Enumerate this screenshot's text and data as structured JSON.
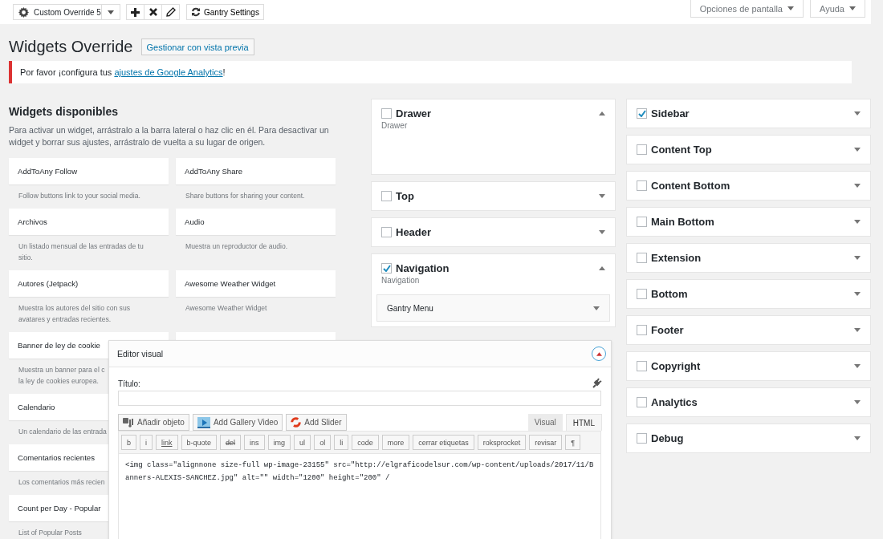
{
  "toolbar": {
    "override_select": "Custom Override 5",
    "gantry_settings": "Gantry Settings"
  },
  "screen_meta": {
    "screen_options": "Opciones de pantalla",
    "help": "Ayuda"
  },
  "page_title": "Widgets Override",
  "preview_button": "Gestionar con vista previa",
  "notice": {
    "text": "Por favor ¡configura tus ",
    "link": "ajustes de Google Analytics",
    "after": "!"
  },
  "available": {
    "title": "Widgets disponibles",
    "description": "Para activar un widget, arrástralo a la barra lateral o haz clic en él. Para desactivar un widget y borrar sus ajustes, arrástralo de vuelta a su lugar de origen.",
    "widget_rows": [
      [
        {
          "kind": "widget",
          "name": "AddToAny Follow",
          "description": [
            "Follow buttons link to your social media."
          ]
        },
        {
          "kind": "widget",
          "name": "AddToAny Share",
          "description": [
            "Share buttons for sharing your content."
          ]
        }
      ],
      [
        {
          "kind": "widget",
          "name": "Archivos",
          "description": [
            "Un listado mensual de las entradas de tu",
            "sitio."
          ]
        },
        {
          "kind": "widget",
          "name": "Audio",
          "description": [
            "Muestra un reproductor de audio."
          ]
        }
      ],
      [
        {
          "kind": "widget",
          "name": "Autores (Jetpack)",
          "description": [
            "Muestra los autores del sitio con sus",
            "avatares y entradas recientes."
          ]
        },
        {
          "kind": "widget",
          "name": "Awesome Weather Widget",
          "description": [
            "Awesome Weather Widget"
          ]
        }
      ],
      [
        {
          "kind": "widget",
          "name": "Banner de ley de cookie",
          "description": [
            "Muestra un banner para el c",
            "la ley de cookies europea."
          ]
        },
        {
          "kind": "covered"
        }
      ],
      [
        {
          "kind": "widget",
          "name": "Calendario",
          "description": [
            "Un calendario de las entrada"
          ]
        }
      ],
      [
        {
          "kind": "widget",
          "name": "Comentarios recientes",
          "description": [
            "Los comentarios más recien"
          ]
        }
      ],
      [
        {
          "kind": "widget",
          "name": "Count per Day - Popular",
          "description": [
            "List of Popular Posts"
          ]
        }
      ]
    ]
  },
  "sidebars_middle": [
    {
      "name": "Drawer",
      "checked": false,
      "expanded": true,
      "description": "Drawer"
    },
    {
      "name": "Top",
      "checked": false,
      "expanded": false
    },
    {
      "name": "Header",
      "checked": false,
      "expanded": false
    },
    {
      "name": "Navigation",
      "checked": true,
      "expanded": true,
      "description": "Navigation",
      "widgets": [
        {
          "name": "Gantry Menu"
        }
      ]
    }
  ],
  "sidebars_right": [
    {
      "name": "Sidebar",
      "checked": true,
      "expanded": false
    },
    {
      "name": "Content Top",
      "checked": false,
      "expanded": false
    },
    {
      "name": "Content Bottom",
      "checked": false,
      "expanded": false
    },
    {
      "name": "Main Bottom",
      "checked": false,
      "expanded": false
    },
    {
      "name": "Extension",
      "checked": false,
      "expanded": false
    },
    {
      "name": "Bottom",
      "checked": false,
      "expanded": false
    },
    {
      "name": "Footer",
      "checked": false,
      "expanded": false
    },
    {
      "name": "Copyright",
      "checked": false,
      "expanded": false
    },
    {
      "name": "Analytics",
      "checked": false,
      "expanded": false
    },
    {
      "name": "Debug",
      "checked": false,
      "expanded": false
    }
  ],
  "editor": {
    "title": "Editor visual",
    "field_label": "Título:",
    "media_buttons": [
      {
        "kind": "media",
        "label": "Añadir objeto"
      },
      {
        "kind": "video",
        "label": "Add Gallery Video"
      },
      {
        "kind": "slider",
        "label": "Add Slider"
      }
    ],
    "tabs": [
      {
        "label": "Visual",
        "selected": false
      },
      {
        "label": "HTML",
        "selected": true
      }
    ],
    "quicktags": [
      {
        "label": "b",
        "kind": "plain"
      },
      {
        "label": "i",
        "kind": "plain"
      },
      {
        "label": "link",
        "kind": "underline"
      },
      {
        "label": "b-quote",
        "kind": "plain"
      },
      {
        "label": "del",
        "kind": "strike"
      },
      {
        "label": "ins",
        "kind": "plain"
      },
      {
        "label": "img",
        "kind": "plain"
      },
      {
        "label": "ul",
        "kind": "plain"
      },
      {
        "label": "ol",
        "kind": "plain"
      },
      {
        "label": "li",
        "kind": "plain"
      },
      {
        "label": "code",
        "kind": "plain"
      },
      {
        "label": "more",
        "kind": "plain"
      },
      {
        "label": "cerrar etiquetas",
        "kind": "plain"
      },
      {
        "label": "roksprocket",
        "kind": "plain"
      },
      {
        "label": "revisar",
        "kind": "plain"
      },
      {
        "label": "¶",
        "kind": "plain"
      }
    ],
    "content": "<img class=\"alignnone size-full wp-image-23155\" src=\"http://elgraficodelsur.com/wp-content/uploads/2017/11/Banners-ALEXIS-SANCHEZ.jpg\" alt=\"\" width=\"1200\" height=\"200\" /"
  }
}
